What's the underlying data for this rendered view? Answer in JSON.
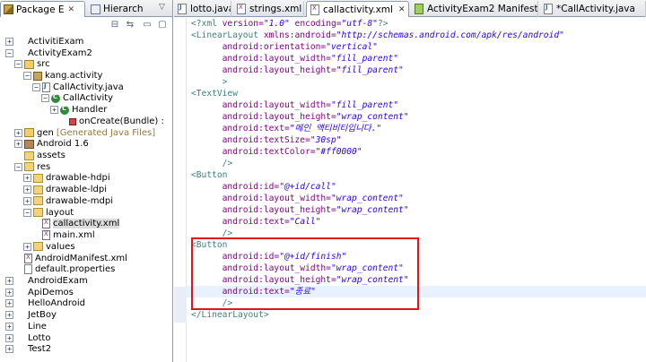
{
  "left_panel": {
    "tabs": [
      {
        "label": "Package E",
        "close": "✕"
      },
      {
        "label": "Hierarchy"
      }
    ],
    "toolbar": {
      "collapse_icon": "collapse-all-icon",
      "link_icon": "link-with-editor-icon",
      "menu_icon": "view-menu-icon"
    },
    "tree": [
      {
        "label": "ActivitiExam",
        "toggle": "+",
        "icon": "project",
        "depth": 0
      },
      {
        "label": "ActivityExam2",
        "toggle": "−",
        "icon": "project",
        "depth": 0
      },
      {
        "label": "src",
        "toggle": "−",
        "icon": "srcfolder",
        "depth": 1
      },
      {
        "label": "kang.activity",
        "toggle": "−",
        "icon": "pkg",
        "depth": 2
      },
      {
        "label": "CallActivity.java",
        "toggle": "−",
        "icon": "java",
        "depth": 3
      },
      {
        "label": "CallActivity",
        "toggle": "−",
        "icon": "class",
        "depth": 4
      },
      {
        "label": "Handler",
        "toggle": "+",
        "icon": "class",
        "depth": 5
      },
      {
        "label": "onCreate(Bundle) :",
        "toggle": "",
        "icon": "method",
        "depth": 6
      },
      {
        "label": "gen",
        "suffix": "[Generated Java Files]",
        "toggle": "+",
        "icon": "srcfolder",
        "depth": 1
      },
      {
        "label": "Android 1.6",
        "toggle": "+",
        "icon": "lib",
        "depth": 1
      },
      {
        "label": "assets",
        "toggle": "",
        "icon": "folder",
        "depth": 1
      },
      {
        "label": "res",
        "toggle": "−",
        "icon": "folder",
        "depth": 1
      },
      {
        "label": "drawable-hdpi",
        "toggle": "+",
        "icon": "folder",
        "depth": 2
      },
      {
        "label": "drawable-ldpi",
        "toggle": "+",
        "icon": "folder",
        "depth": 2
      },
      {
        "label": "drawable-mdpi",
        "toggle": "+",
        "icon": "folder",
        "depth": 2
      },
      {
        "label": "layout",
        "toggle": "−",
        "icon": "folder",
        "depth": 2
      },
      {
        "label": "callactivity.xml",
        "toggle": "",
        "icon": "xml",
        "depth": 3,
        "selected": true
      },
      {
        "label": "main.xml",
        "toggle": "",
        "icon": "xml",
        "depth": 3
      },
      {
        "label": "values",
        "toggle": "+",
        "icon": "folder",
        "depth": 2
      },
      {
        "label": "AndroidManifest.xml",
        "toggle": "",
        "icon": "xml",
        "depth": 1
      },
      {
        "label": "default.properties",
        "toggle": "",
        "icon": "file",
        "depth": 1
      },
      {
        "label": "AndroidExam",
        "toggle": "+",
        "icon": "project",
        "depth": 0
      },
      {
        "label": "ApiDemos",
        "toggle": "+",
        "icon": "project",
        "depth": 0
      },
      {
        "label": "HelloAndroid",
        "toggle": "+",
        "icon": "project",
        "depth": 0
      },
      {
        "label": "JetBoy",
        "toggle": "+",
        "icon": "project",
        "depth": 0
      },
      {
        "label": "Line",
        "toggle": "+",
        "icon": "project",
        "depth": 0
      },
      {
        "label": "Lotto",
        "toggle": "+",
        "icon": "project",
        "depth": 0
      },
      {
        "label": "Test2",
        "toggle": "+",
        "icon": "project",
        "depth": 0
      }
    ]
  },
  "editor": {
    "tabs": [
      {
        "label": "lotto.java",
        "icon": "java"
      },
      {
        "label": "strings.xml",
        "icon": "xml"
      },
      {
        "label": "callactivity.xml",
        "icon": "xml",
        "active": true,
        "close": "✕"
      },
      {
        "label": "ActivityExam2 Manifest",
        "icon": "manifest"
      },
      {
        "label": "*CallActivity.java",
        "icon": "java"
      }
    ],
    "lines": [
      [
        [
          "pi",
          "<?xml "
        ],
        [
          "attr",
          "version="
        ],
        [
          "val",
          "\"1.0\""
        ],
        [
          "attr",
          " encoding="
        ],
        [
          "val",
          "\"utf-8\""
        ],
        [
          "pi",
          "?>"
        ]
      ],
      [
        [
          "tag",
          "<LinearLayout "
        ],
        [
          "attr",
          "xmlns:android="
        ],
        [
          "val",
          "\"http://schemas.android.com/apk/res/android\""
        ]
      ],
      [
        [
          "",
          "      "
        ],
        [
          "attr",
          "android:orientation="
        ],
        [
          "val",
          "\"vertical\""
        ]
      ],
      [
        [
          "",
          "      "
        ],
        [
          "attr",
          "android:layout_width="
        ],
        [
          "val",
          "\"fill_parent\""
        ]
      ],
      [
        [
          "",
          "      "
        ],
        [
          "attr",
          "android:layout_height="
        ],
        [
          "val",
          "\"fill_parent\""
        ]
      ],
      [
        [
          "",
          "      "
        ],
        [
          "tag",
          ">"
        ]
      ],
      [
        [
          "tag",
          "<TextView"
        ]
      ],
      [
        [
          "",
          "      "
        ],
        [
          "attr",
          "android:layout_width="
        ],
        [
          "val",
          "\"fill_parent\""
        ]
      ],
      [
        [
          "",
          "      "
        ],
        [
          "attr",
          "android:layout_height="
        ],
        [
          "val",
          "\"wrap_content\""
        ]
      ],
      [
        [
          "",
          "      "
        ],
        [
          "attr",
          "android:text="
        ],
        [
          "val",
          "\"메인 액티비티입니다.\""
        ]
      ],
      [
        [
          "",
          "      "
        ],
        [
          "attr",
          "android:textSize="
        ],
        [
          "val",
          "\"30sp\""
        ]
      ],
      [
        [
          "",
          "      "
        ],
        [
          "attr",
          "android:textColor="
        ],
        [
          "val",
          "\"#ff0000\""
        ]
      ],
      [
        [
          "",
          "      "
        ],
        [
          "tag",
          "/>"
        ]
      ],
      [
        [
          "tag",
          "<Button"
        ]
      ],
      [
        [
          "",
          "      "
        ],
        [
          "attr",
          "android:id="
        ],
        [
          "val",
          "\"@+id/call\""
        ]
      ],
      [
        [
          "",
          "      "
        ],
        [
          "attr",
          "android:layout_width="
        ],
        [
          "val",
          "\"wrap_content\""
        ]
      ],
      [
        [
          "",
          "      "
        ],
        [
          "attr",
          "android:layout_height="
        ],
        [
          "val",
          "\"wrap_content\""
        ]
      ],
      [
        [
          "",
          "      "
        ],
        [
          "attr",
          "android:text="
        ],
        [
          "val",
          "\"Call\""
        ]
      ],
      [
        [
          "",
          "      "
        ],
        [
          "tag",
          "/>"
        ]
      ],
      [
        [
          "tag",
          "<Button"
        ]
      ],
      [
        [
          "",
          "      "
        ],
        [
          "attr",
          "android:id="
        ],
        [
          "val",
          "\"@+id/finish\""
        ]
      ],
      [
        [
          "",
          "      "
        ],
        [
          "attr",
          "android:layout_width="
        ],
        [
          "val",
          "\"wrap_content\""
        ]
      ],
      [
        [
          "",
          "      "
        ],
        [
          "attr",
          "android:layout_height="
        ],
        [
          "val",
          "\"wrap_content\""
        ]
      ],
      [
        [
          "",
          "      "
        ],
        [
          "attr",
          "android:text="
        ],
        [
          "val",
          "\"종료\""
        ]
      ],
      [
        [
          "",
          "      "
        ],
        [
          "tag",
          "/>"
        ]
      ],
      [
        [
          "tag",
          "</LinearLayout>"
        ]
      ]
    ]
  },
  "colors": {
    "highlight_box": "#e0141a",
    "xml_tag": "#3f7f7f",
    "xml_attr": "#7f007f",
    "xml_value": "#2a00ff"
  }
}
